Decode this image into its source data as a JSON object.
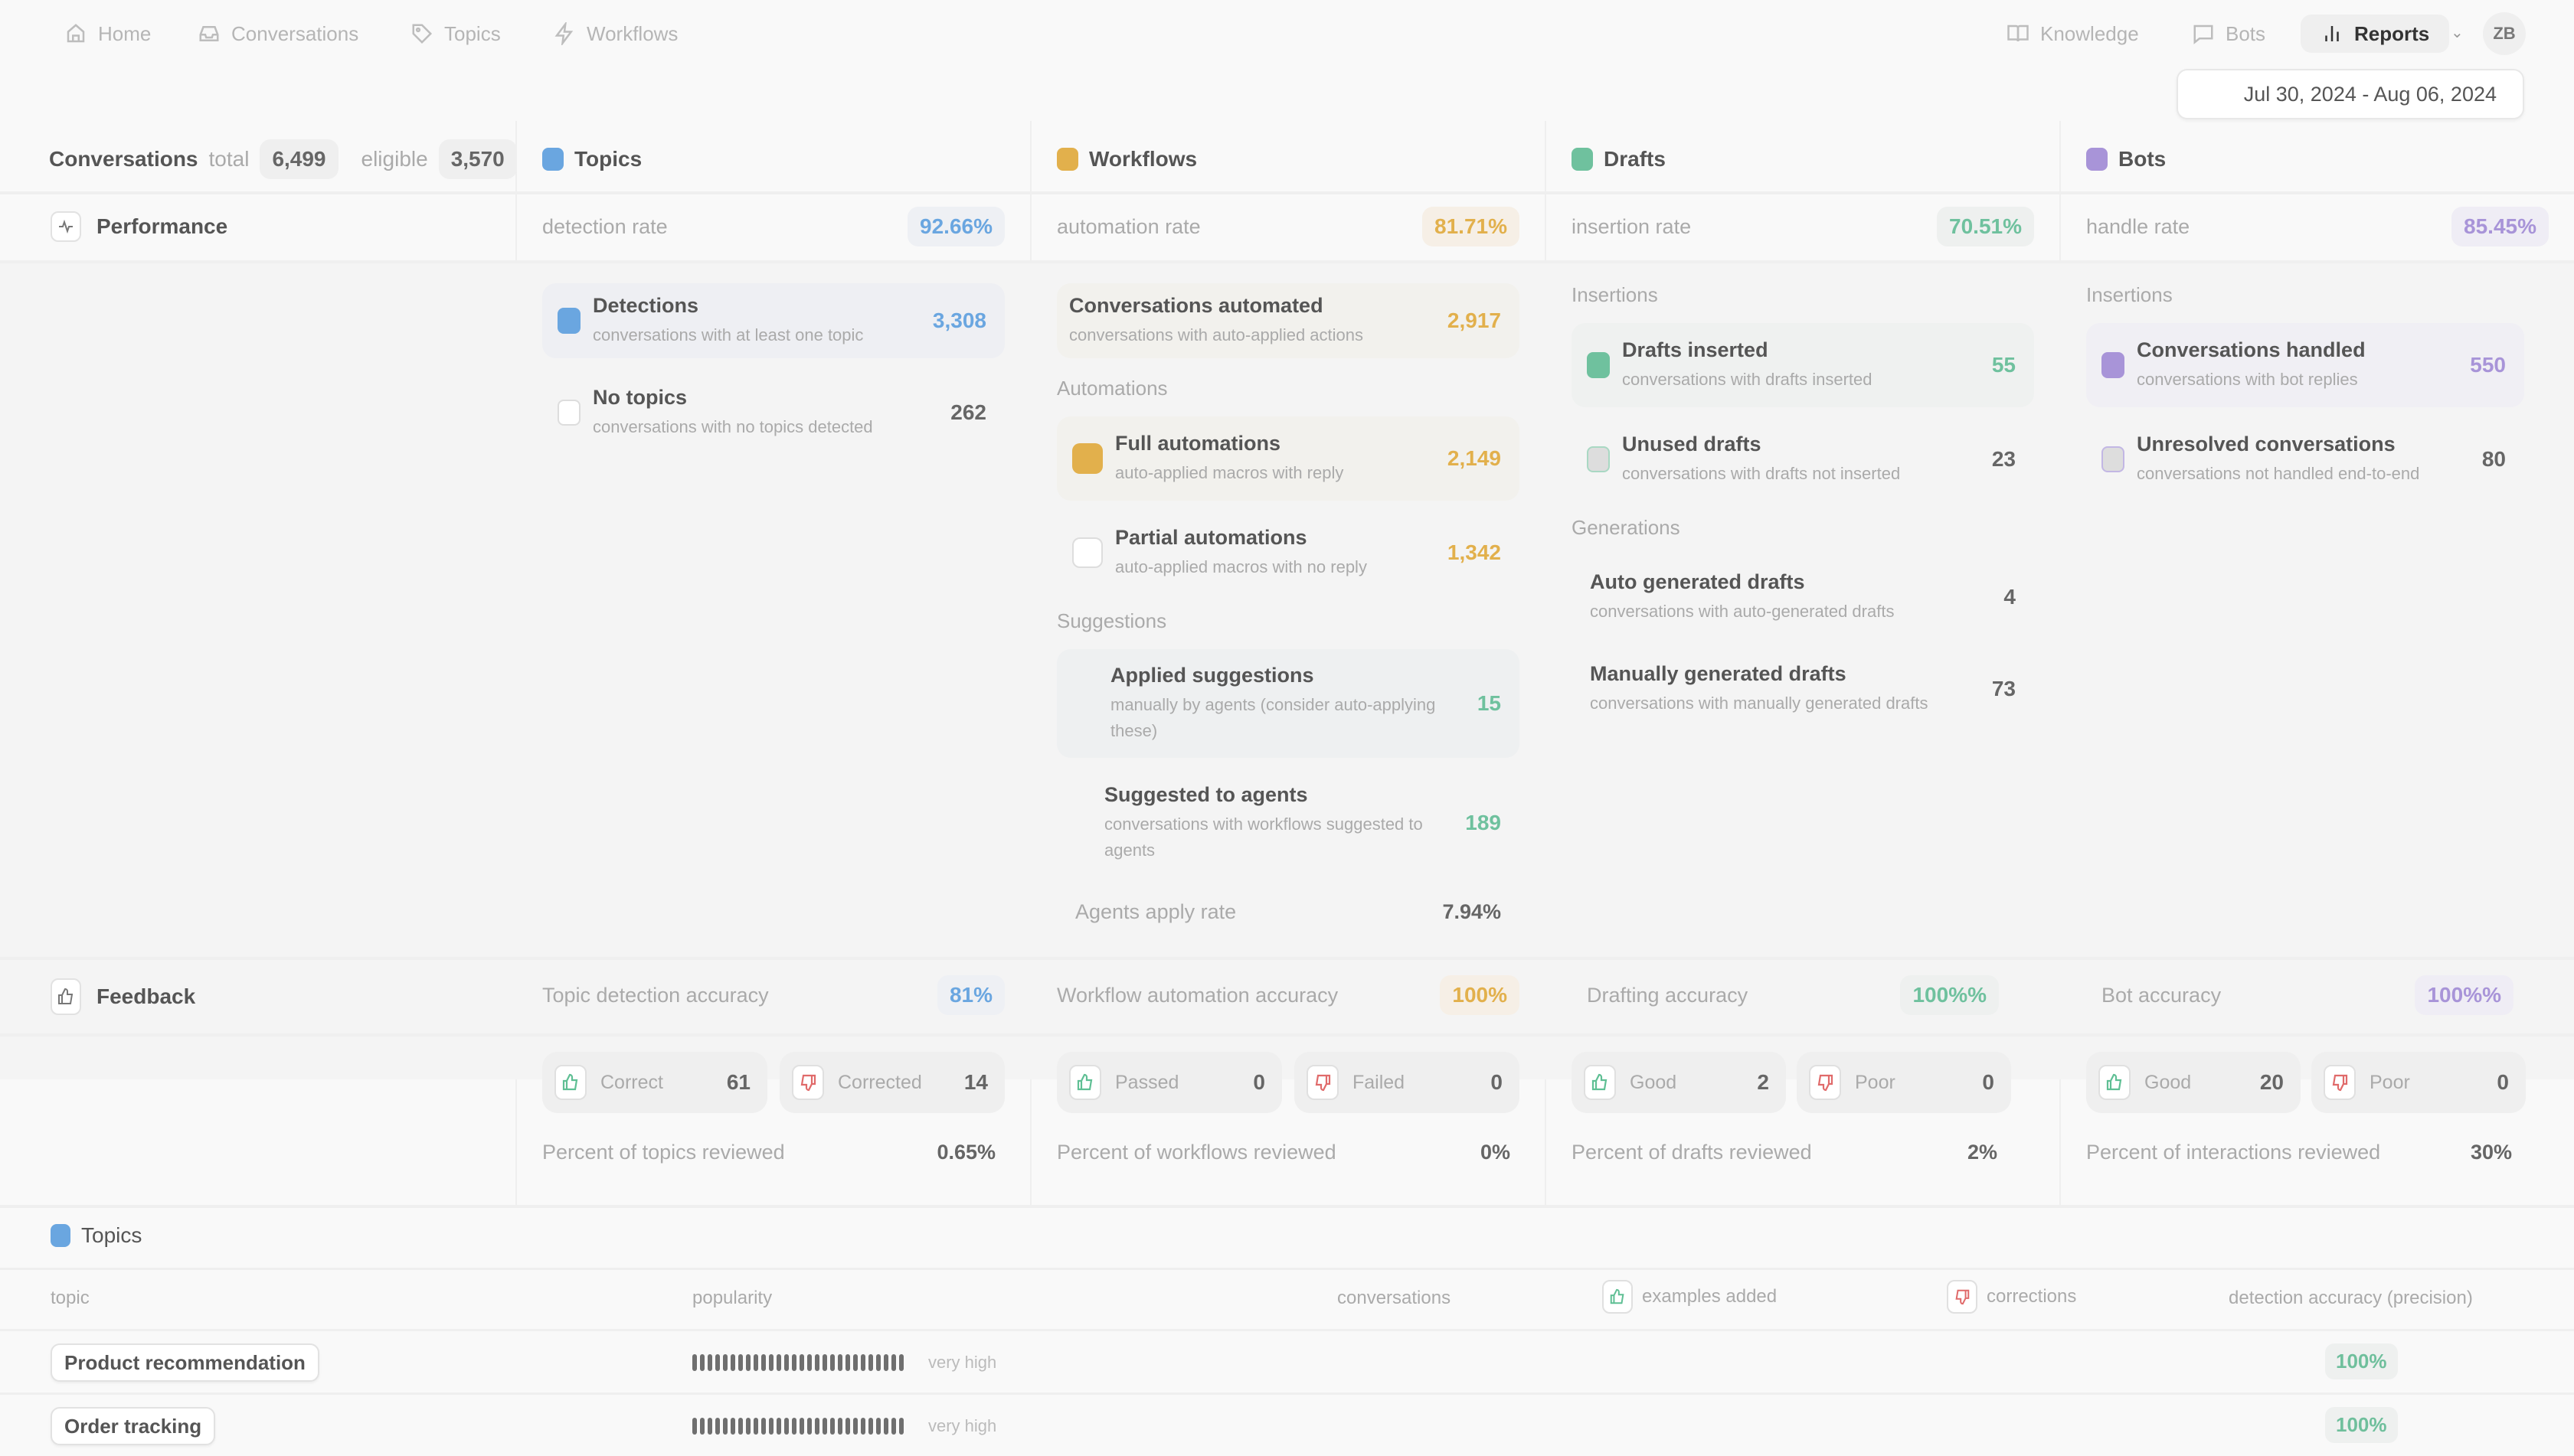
{
  "nav": {
    "left": [
      {
        "label": "Home",
        "icon": "home-icon"
      },
      {
        "label": "Conversations",
        "icon": "inbox-icon"
      },
      {
        "label": "Topics",
        "icon": "tag-icon"
      },
      {
        "label": "Workflows",
        "icon": "lightning-icon"
      }
    ],
    "right": [
      {
        "label": "Knowledge",
        "icon": "book-icon"
      },
      {
        "label": "Bots",
        "icon": "message-icon"
      },
      {
        "label": "Reports",
        "icon": "bar-chart-icon",
        "active": true
      }
    ],
    "avatar": "ZB",
    "date_range": "Jul 30, 2024 - Aug 06, 2024"
  },
  "colors": {
    "topics": "#6aa6e0",
    "workflows": "#e2b04c",
    "drafts": "#6fc19e",
    "bots": "#a894d8",
    "thumb_up": "#5fbf94",
    "thumb_down": "#e06a6a"
  },
  "conversations": {
    "title": "Conversations",
    "total_label": "total",
    "total": "6,499",
    "eligible_label": "eligible",
    "eligible": "3,570"
  },
  "performance": {
    "label": "Performance",
    "topics": {
      "title": "Topics",
      "metric_label": "detection rate",
      "metric_value": "92.66%",
      "cards": [
        {
          "title": "Detections",
          "sub": "conversations with at least one topic",
          "value": "3,308"
        },
        {
          "title": "No topics",
          "sub": "conversations with no topics detected",
          "value": "262"
        }
      ]
    },
    "workflows": {
      "title": "Workflows",
      "metric_label": "automation rate",
      "metric_value": "81.71%",
      "automated": {
        "title": "Conversations automated",
        "sub": "conversations with auto-applied actions",
        "value": "2,917"
      },
      "automations_header": "Automations",
      "automations": [
        {
          "title": "Full automations",
          "sub": "auto-applied macros with reply",
          "value": "2,149"
        },
        {
          "title": "Partial automations",
          "sub": "auto-applied macros with no reply",
          "value": "1,342"
        }
      ],
      "suggestions_header": "Suggestions",
      "suggestions": [
        {
          "title": "Applied suggestions",
          "sub": "manually by agents (consider auto-applying these)",
          "value": "15"
        },
        {
          "title": "Suggested to agents",
          "sub": "conversations with workflows suggested to agents",
          "value": "189"
        }
      ],
      "apply_rate_label": "Agents apply rate",
      "apply_rate": "7.94%"
    },
    "drafts": {
      "title": "Drafts",
      "metric_label": "insertion rate",
      "metric_value": "70.51%",
      "insertions_header": "Insertions",
      "insertions": [
        {
          "title": "Drafts inserted",
          "sub": "conversations with drafts inserted",
          "value": "55"
        },
        {
          "title": "Unused drafts",
          "sub": "conversations with drafts not inserted",
          "value": "23"
        }
      ],
      "generations_header": "Generations",
      "generations": [
        {
          "title": "Auto generated drafts",
          "sub": "conversations with auto-generated drafts",
          "value": "4"
        },
        {
          "title": "Manually generated drafts",
          "sub": "conversations with manually generated drafts",
          "value": "73"
        }
      ]
    },
    "bots": {
      "title": "Bots",
      "metric_label": "handle rate",
      "metric_value": "85.45%",
      "insertions_header": "Insertions",
      "cards": [
        {
          "title": "Conversations handled",
          "sub": "conversations with bot replies",
          "value": "550"
        },
        {
          "title": "Unresolved conversations",
          "sub": "conversations not handled end-to-end",
          "value": "80"
        }
      ]
    }
  },
  "feedback": {
    "label": "Feedback",
    "topics": {
      "metric_label": "Topic detection accuracy",
      "metric_value": "81%",
      "good_label": "Correct",
      "good": "61",
      "bad_label": "Corrected",
      "bad": "14",
      "reviewed_label": "Percent of topics reviewed",
      "reviewed": "0.65%"
    },
    "workflows": {
      "metric_label": "Workflow automation accuracy",
      "metric_value": "100%",
      "good_label": "Passed",
      "good": "0",
      "bad_label": "Failed",
      "bad": "0",
      "reviewed_label": "Percent of workflows reviewed",
      "reviewed": "0%"
    },
    "drafts": {
      "metric_label": "Drafting accuracy",
      "metric_value": "100%%",
      "good_label": "Good",
      "good": "2",
      "bad_label": "Poor",
      "bad": "0",
      "reviewed_label": "Percent of drafts reviewed",
      "reviewed": "2%"
    },
    "bots": {
      "metric_label": "Bot accuracy",
      "metric_value": "100%%",
      "good_label": "Good",
      "good": "20",
      "bad_label": "Poor",
      "bad": "0",
      "reviewed_label": "Percent of interactions reviewed",
      "reviewed": "30%"
    }
  },
  "topics_table": {
    "title": "Topics",
    "columns": [
      "topic",
      "popularity",
      "conversations",
      "examples added",
      "corrections",
      "detection accuracy (precision)"
    ],
    "rows": [
      {
        "topic": "Product recommendation",
        "popularity_level": 1.0,
        "popularity_label": "very high",
        "conversations": "",
        "examples_added": "",
        "corrections": "",
        "accuracy": "100%"
      },
      {
        "topic": "Order tracking",
        "popularity_level": 1.0,
        "popularity_label": "very high",
        "conversations": "",
        "examples_added": "",
        "corrections": "",
        "accuracy": "100%"
      }
    ]
  }
}
